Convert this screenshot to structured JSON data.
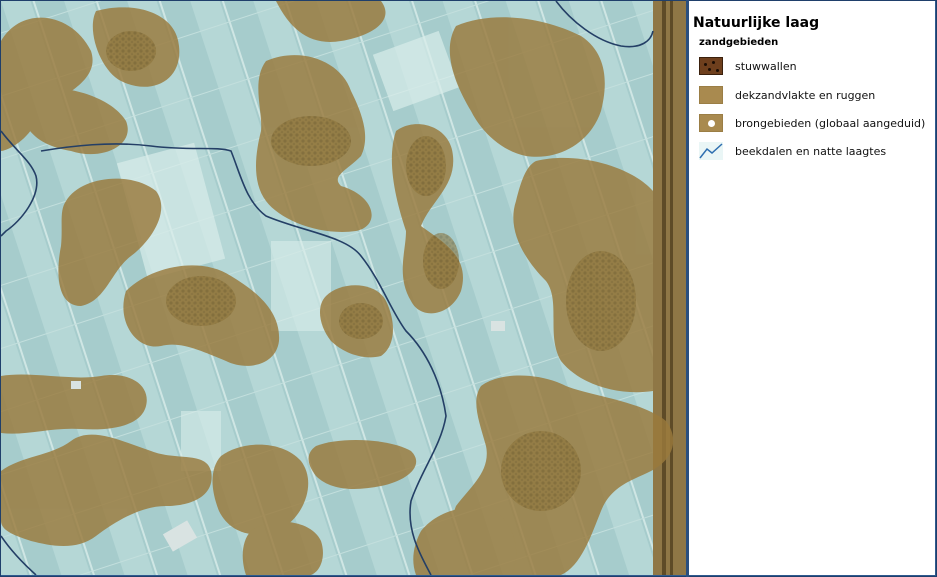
{
  "legend": {
    "title": "Natuurlijke laag",
    "group": "zandgebieden",
    "items": [
      {
        "label": "stuwwallen",
        "icon": "stuwwallen-swatch-icon",
        "color": "#6e3f1d"
      },
      {
        "label": "dekzandvlakte en ruggen",
        "icon": "dekzand-swatch-icon",
        "color": "#a98a4f"
      },
      {
        "label": "brongebieden (globaal aangeduid)",
        "icon": "brongebied-swatch-icon",
        "color": "#a98a4f"
      },
      {
        "label": "beekdalen en natte laagtes",
        "icon": "beekdal-line-icon",
        "color": "#2f6fb0"
      }
    ]
  },
  "colors": {
    "map_base": "#a9cfcf",
    "sand_overlay": "#9a7a3c",
    "boundary_line": "#243f66",
    "frame": "#1f3f6b"
  }
}
